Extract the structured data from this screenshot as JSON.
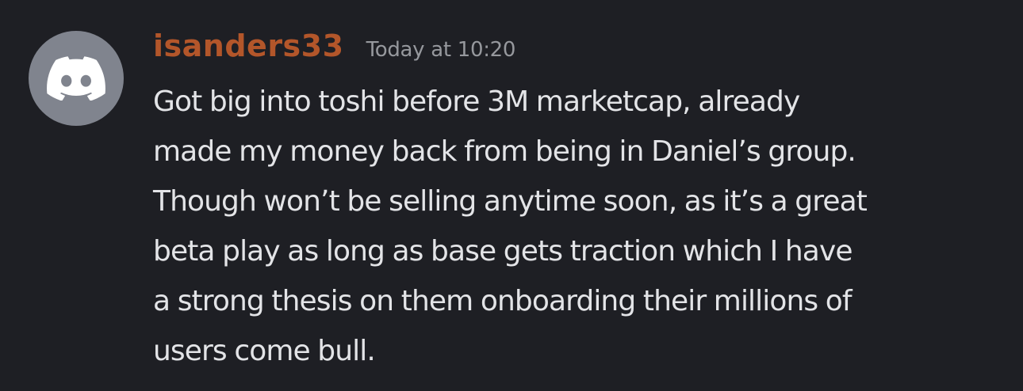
{
  "message": {
    "author": {
      "username": "isanders33",
      "avatar_icon": "discord-logo-icon"
    },
    "timestamp": "Today at 10:20",
    "content_lines": [
      "Got big into toshi before 3M marketcap, already",
      "made my money back from being in Daniel’s group.",
      "Though won’t be selling anytime soon, as it’s a great",
      "beta play as long as base gets traction which I have",
      "a strong thesis on them onboarding their millions of",
      "users come bull."
    ]
  },
  "colors": {
    "background": "#1e1f24",
    "username": "#b3562a",
    "timestamp": "#96989d",
    "message_text": "#e3e4e7",
    "avatar_background": "#80848e",
    "avatar_icon": "#ffffff"
  }
}
